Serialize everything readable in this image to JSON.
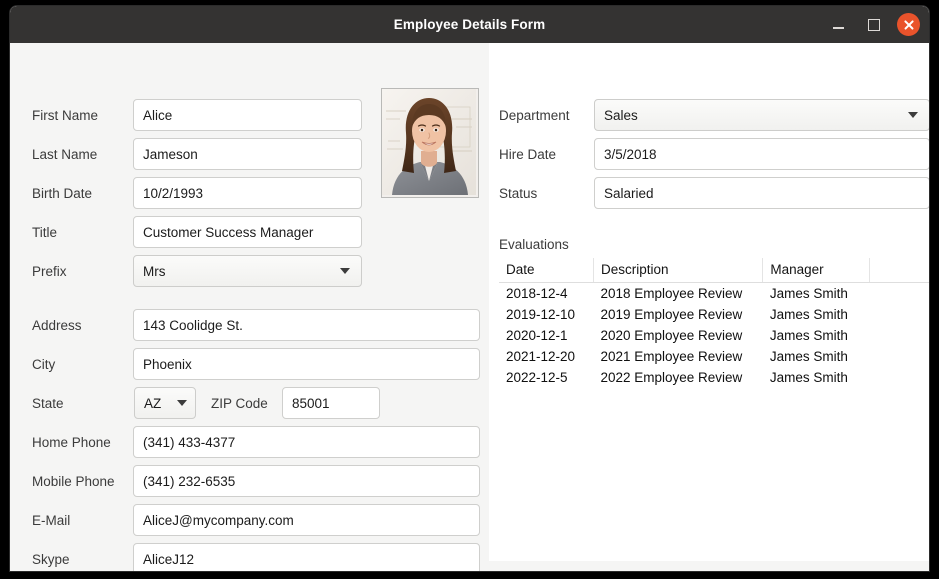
{
  "window": {
    "title": "Employee Details Form",
    "controls": {
      "minimize": "minimize-button",
      "maximize": "maximize-button",
      "close": "close-button"
    },
    "accent_color": "#e9532b",
    "titlebar_color": "#343332",
    "background_color": "#f5f5f4"
  },
  "left_panel": {
    "fields": [
      {
        "label": "First Name",
        "value": "Alice",
        "type": "text"
      },
      {
        "label": "Last Name",
        "value": "Jameson",
        "type": "text"
      },
      {
        "label": "Birth Date",
        "value": "10/2/1993",
        "type": "text"
      },
      {
        "label": "Title",
        "value": "Customer Success Manager",
        "type": "text"
      },
      {
        "label": "Prefix",
        "value": "Mrs",
        "type": "combo"
      },
      {
        "label": "Address",
        "value": "143 Coolidge St.",
        "type": "text"
      },
      {
        "label": "City",
        "value": "Phoenix",
        "type": "text"
      },
      {
        "label": "State",
        "value": "AZ",
        "type": "combo"
      },
      {
        "label": "ZIP Code",
        "value": "85001",
        "type": "text"
      },
      {
        "label": "Home Phone",
        "value": "(341) 433-4377",
        "type": "text"
      },
      {
        "label": "Mobile Phone",
        "value": "(341) 232-6535",
        "type": "text"
      },
      {
        "label": "E-Mail",
        "value": "AliceJ@mycompany.com",
        "type": "text"
      },
      {
        "label": "Skype",
        "value": "AliceJ12",
        "type": "text"
      }
    ],
    "photo": {
      "alt": "employee-portrait",
      "description": "Smiling woman with long brown hair wearing a grey blazer in front of a whiteboard"
    }
  },
  "right_panel": {
    "fields": [
      {
        "label": "Department",
        "value": "Sales",
        "type": "combo"
      },
      {
        "label": "Hire Date",
        "value": "3/5/2018",
        "type": "text"
      },
      {
        "label": "Status",
        "value": "Salaried",
        "type": "text"
      }
    ],
    "evaluations": {
      "title": "Evaluations",
      "columns": [
        "Date",
        "Description",
        "Manager",
        ""
      ],
      "rows": [
        [
          "2018-12-4",
          "2018 Employee Review",
          "James Smith",
          ""
        ],
        [
          "2019-12-10",
          "2019 Employee Review",
          "James Smith",
          ""
        ],
        [
          "2020-12-1",
          "2020 Employee Review",
          "James Smith",
          ""
        ],
        [
          "2021-12-20",
          "2021 Employee Review",
          "James Smith",
          ""
        ],
        [
          "2022-12-5",
          "2022 Employee Review",
          "James Smith",
          ""
        ]
      ]
    }
  }
}
